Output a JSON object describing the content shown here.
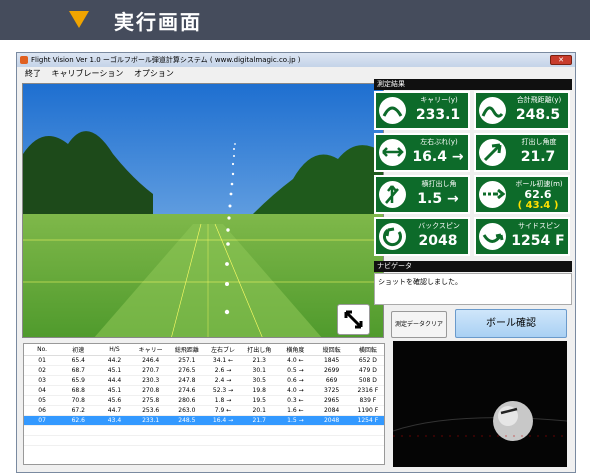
{
  "banner": {
    "title": "実行画面",
    "accent": "#f0a400",
    "bg": "#454c5c"
  },
  "window": {
    "title": "Flight Vision  Ver 1.0  ーゴルフボール弾道計算システム  ( www.digitalmagic.co.jp )",
    "close_icon": "close-icon"
  },
  "menu": [
    "終了",
    "キャリブレーション",
    "オプション"
  ],
  "results": {
    "header": "測定結果",
    "cards": [
      {
        "label": "キャリー(y)",
        "value": "233.1",
        "icon": "carry-arc-icon"
      },
      {
        "label": "合計飛距離(y)",
        "value": "248.5",
        "icon": "total-distance-icon"
      },
      {
        "label": "左右ぶれ(y)",
        "value": "16.4 →",
        "icon": "lateral-offset-icon"
      },
      {
        "label": "打出し角度",
        "value": "21.7",
        "icon": "launch-angle-icon"
      },
      {
        "label": "横打出し角",
        "value": "1.5 →",
        "icon": "side-launch-icon"
      },
      {
        "label": "ボール初速(m)",
        "value": "62.6",
        "value2": "( 43.4 )",
        "icon": "ball-speed-icon"
      },
      {
        "label": "バックスピン",
        "value": "2048",
        "icon": "backspin-icon"
      },
      {
        "label": "サイドスピン",
        "value": "1254 F",
        "icon": "sidespin-icon"
      }
    ]
  },
  "navi": {
    "header": "ナビゲータ",
    "message": "ショットを確認しました。"
  },
  "buttons": {
    "clear": "測定データクリア",
    "ball_check": "ボール確認"
  },
  "table": {
    "headers": [
      "No.",
      "初速",
      "H/S",
      "キャリー",
      "総飛距離",
      "左右ブレ",
      "打出し角",
      "横角度",
      "縦回転",
      "横回転"
    ],
    "rows": [
      [
        "01",
        "65.4",
        "44.2",
        "246.4",
        "257.1",
        "34.1 ←",
        "21.3",
        "4.0 ←",
        "1845",
        "652 D"
      ],
      [
        "02",
        "68.7",
        "45.1",
        "270.7",
        "276.5",
        "2.6 →",
        "30.1",
        "0.5 →",
        "2699",
        "479 D"
      ],
      [
        "03",
        "65.9",
        "44.4",
        "230.3",
        "247.8",
        "2.4 →",
        "30.5",
        "0.6 →",
        "669",
        "508 D"
      ],
      [
        "04",
        "68.8",
        "45.1",
        "270.8",
        "274.6",
        "52.3 →",
        "19.8",
        "4.0 →",
        "3725",
        "2316 F"
      ],
      [
        "05",
        "70.8",
        "45.6",
        "275.8",
        "280.6",
        "1.8 →",
        "19.5",
        "0.3 ←",
        "2965",
        "839 F"
      ],
      [
        "06",
        "67.2",
        "44.7",
        "253.6",
        "263.0",
        "7.9 ←",
        "20.1",
        "1.6 ←",
        "2084",
        "1190 F"
      ],
      [
        "07",
        "62.6",
        "43.4",
        "233.1",
        "248.5",
        "16.4 →",
        "21.7",
        "1.5 →",
        "2048",
        "1254 F"
      ]
    ],
    "selected_row": 6
  },
  "colors": {
    "card_green": "#0d6b2a",
    "ball_speed_highlight": "#ffe000",
    "selected_row": "#3399ff"
  }
}
